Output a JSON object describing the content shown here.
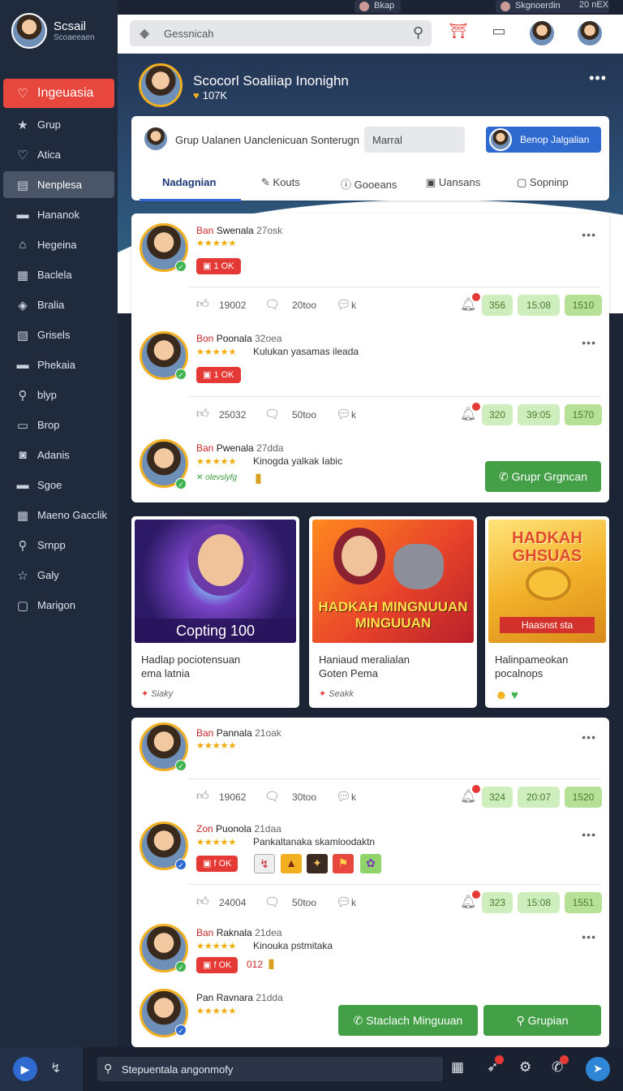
{
  "topstrip": {
    "left_pill": "Bkap",
    "right_pill": "Skgnoerdin",
    "right_text": "20 nEX"
  },
  "profile": {
    "name": "Scsail",
    "subname": "Scoaeeaen"
  },
  "sidebar": {
    "items": [
      {
        "label": "Ingeuasia",
        "icon": "heart-outline-icon",
        "glyph": "♡",
        "state": "active"
      },
      {
        "label": "Grup",
        "icon": "star-icon",
        "glyph": "★",
        "state": ""
      },
      {
        "label": "Atica",
        "icon": "heart-icon",
        "glyph": "♡",
        "state": ""
      },
      {
        "label": "Nenplesa",
        "icon": "list-icon",
        "glyph": "▤",
        "state": "sel"
      },
      {
        "label": "Hananok",
        "icon": "chat-icon",
        "glyph": "▬",
        "state": ""
      },
      {
        "label": "Hegeina",
        "icon": "home-icon",
        "glyph": "⌂",
        "state": ""
      },
      {
        "label": "Baclela",
        "icon": "grid-icon",
        "glyph": "▦",
        "state": ""
      },
      {
        "label": "Bralia",
        "icon": "shield-icon",
        "glyph": "◈",
        "state": ""
      },
      {
        "label": "Grisels",
        "icon": "document-icon",
        "glyph": "▧",
        "state": ""
      },
      {
        "label": "Phekaia",
        "icon": "chat-bubble-icon",
        "glyph": "▬",
        "state": ""
      },
      {
        "label": "blyp",
        "icon": "search-icon",
        "glyph": "⚲",
        "state": ""
      },
      {
        "label": "Brop",
        "icon": "briefcase-icon",
        "glyph": "▭",
        "state": ""
      },
      {
        "label": "Adanis",
        "icon": "camera-icon",
        "glyph": "◙",
        "state": ""
      },
      {
        "label": "Sgoe",
        "icon": "message-icon",
        "glyph": "▬",
        "state": ""
      },
      {
        "label": "Maeno Gacclik",
        "icon": "table-icon",
        "glyph": "▦",
        "state": ""
      },
      {
        "label": "Srnpp",
        "icon": "search-icon",
        "glyph": "⚲",
        "state": ""
      },
      {
        "label": "Galy",
        "icon": "star-outline-icon",
        "glyph": "☆",
        "state": ""
      },
      {
        "label": "Marigon",
        "icon": "folder-icon",
        "glyph": "▢",
        "state": ""
      }
    ]
  },
  "header": {
    "search_placeholder": "Gessnicah"
  },
  "group": {
    "title": "Scocorl Soaliiap Inonighn",
    "likes": "107K"
  },
  "joinbar": {
    "text": "Grup Ualanen Uanclenicuan Sonterugn",
    "input_value": "Marral",
    "button_label": "Benop Jalgalian"
  },
  "tabs": [
    {
      "label": "Nadagnian",
      "icon": "",
      "active": true
    },
    {
      "label": "Kouts",
      "icon": "✎",
      "active": false
    },
    {
      "label": "Gooeans",
      "icon": "ⓘ",
      "active": false
    },
    {
      "label": "Uansans",
      "icon": "▣",
      "active": false
    },
    {
      "label": "Sopninp",
      "icon": "▢",
      "active": false
    }
  ],
  "posts1": [
    {
      "prefix": "Ban",
      "name": "Swenala",
      "time": "27osk",
      "line": "",
      "badge": "1 OK",
      "likes": "19002",
      "comments": "20too",
      "shares": "k",
      "g1": "356",
      "g2": "15:08",
      "g3": "1510"
    },
    {
      "prefix": "Bon",
      "name": "Poonala",
      "time": "32oea",
      "line": "Kulukan yasamas ileada",
      "badge": "1 OK",
      "likes": "25032",
      "comments": "50too",
      "shares": "k",
      "g1": "320",
      "g2": "39:05",
      "g3": "1570"
    },
    {
      "prefix": "Ban",
      "name": "Pwenala",
      "time": "27dda",
      "line": "Kinogda yalkak Iabic",
      "tagline": "olevslyfg",
      "button": "Grupr Grgncan"
    }
  ],
  "tiles": [
    {
      "caption": "Copting 100",
      "title1": "Hadlap pociotensuan",
      "title2": "ema latnia",
      "tag": "Siaky"
    },
    {
      "caption1": "HADKAH MINGNUUAN",
      "caption2": "MINGUUAN",
      "title1": "Haniaud meralialan",
      "title2": "Goten Pema",
      "tag": "Seakk"
    },
    {
      "caption1": "HADKAH",
      "caption2": "GHSUAS",
      "strip": "Haasnst sta",
      "title1": "Halinpameokan",
      "title2": "pocalnops"
    }
  ],
  "posts2": [
    {
      "prefix": "Ban",
      "name": "Pannala",
      "time": "21oak",
      "likes": "19062",
      "comments": "30too",
      "shares": "k",
      "g1": "324",
      "g2": "20:07",
      "g3": "1520"
    },
    {
      "prefix": "Zon",
      "name": "Puonola",
      "time": "21daa",
      "line": "Pankaltanaka skamloodaktn",
      "badge": "f OK",
      "likes": "24004",
      "comments": "50too",
      "shares": "k",
      "g1": "323",
      "g2": "15:08",
      "g3": "1551"
    },
    {
      "prefix": "Ban",
      "name": "Raknala",
      "time": "21dea",
      "line": "Kinouka pstmitaka",
      "badge": "f OK",
      "badge_extra": "012"
    },
    {
      "prefix": "Pan",
      "name": "Ravnara",
      "time": "21dda",
      "button1": "Staclach Minguuan",
      "button2": "Grupian"
    }
  ],
  "bottombar": {
    "search_value": "Stepuentala angonmofy"
  },
  "colors": {
    "accent_red": "#e8473e",
    "accent_blue": "#2f6ad0",
    "accent_green": "#43a047",
    "sidebar_bg": "#1f2a3d",
    "star_gold": "#f2a900"
  }
}
